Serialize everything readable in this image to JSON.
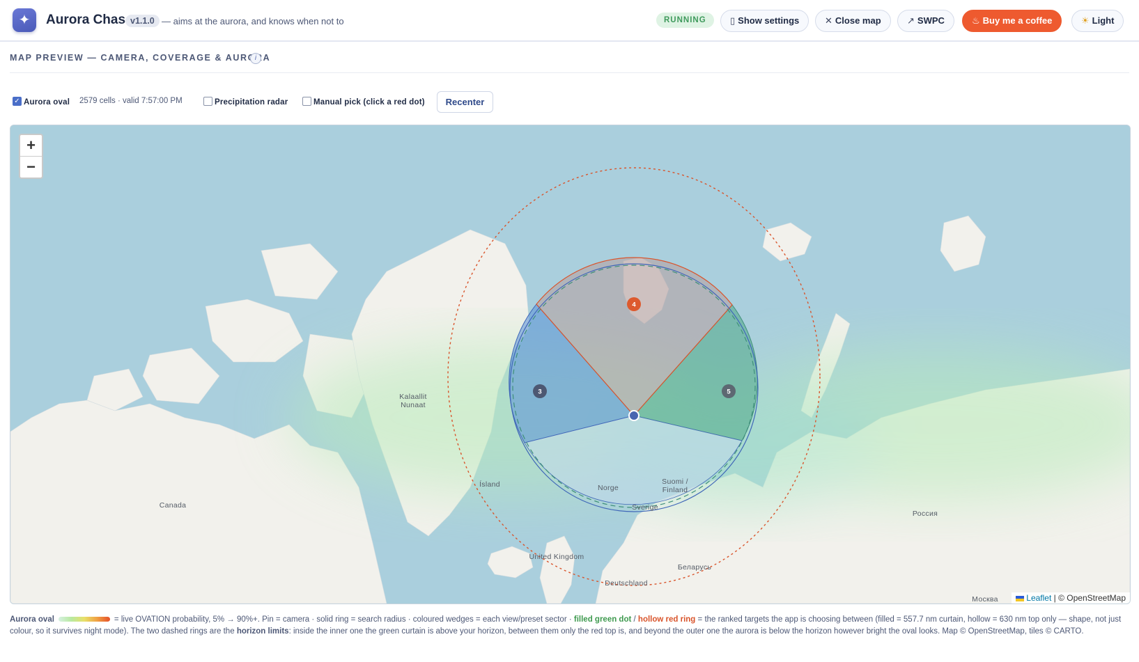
{
  "header": {
    "app_title": "Aurora Chaser",
    "version": "v1.1.0",
    "tagline": "— aims at the aurora, and knows when not to",
    "status": "RUNNING",
    "buttons": {
      "show_settings": "Show settings",
      "close_map": "Close map",
      "swpc": "SWPC",
      "coffee": "Buy me a coffee",
      "theme": "Light"
    }
  },
  "section": {
    "title": "MAP PREVIEW — CAMERA, COVERAGE & AURORA",
    "info": "i"
  },
  "controls": {
    "aurora_oval_label": "Aurora oval",
    "aurora_oval_checked": true,
    "oval_info": "2579 cells · valid 7:57:00 PM",
    "precip_label": "Precipitation radar",
    "precip_checked": false,
    "manual_label": "Manual pick (click a red dot)",
    "manual_checked": false,
    "recenter": "Recenter"
  },
  "map": {
    "zoom_in": "+",
    "zoom_out": "−",
    "labels": {
      "greenland_1": "Kalaallit",
      "greenland_2": "Nunaat",
      "island": "Ísland",
      "canada": "Canada",
      "norge": "Norge",
      "sverige": "Sverige",
      "finland_1": "Suomi /",
      "finland_2": "Finland",
      "uk": "United Kingdom",
      "belarus": "Беларусь",
      "deutschland": "Deutschland",
      "russia": "Россия",
      "moscow": "Москва"
    },
    "targets": [
      {
        "number": "4",
        "kind": "hollow red ring"
      },
      {
        "number": "3",
        "kind": "preset"
      },
      {
        "number": "5",
        "kind": "preset"
      }
    ],
    "attribution": {
      "leaflet": "Leaflet",
      "separator": " | ",
      "osm": "© OpenStreetMap"
    },
    "colors": {
      "sea": "#aacfdd",
      "land": "#f2f1ec",
      "camera_pin": "#4a66b0",
      "red": "#d9542b",
      "green": "#3f8f7a",
      "blue": "#3f66b8"
    }
  },
  "caption": {
    "legend_label": "Aurora oval",
    "p1": "= live OVATION probability, 5% → 90%+. Pin = camera · solid ring = search radius · coloured wedges = each view/preset sector ·",
    "green": "filled green dot",
    "slash": "/",
    "red": "hollow red ring",
    "p2": "= the ranked targets the app is choosing between (filled = 557.7 nm curtain, hollow = 630 nm top only — shape, not just colour, so it survives night mode). The two dashed rings are the",
    "horizon": "horizon limits",
    "p3": ": inside the inner one the green curtain is above your horizon, between them only the red top is, and beyond the outer one the aurora is below the horizon however bright the oval looks. Map © OpenStreetMap, tiles © CARTO."
  }
}
